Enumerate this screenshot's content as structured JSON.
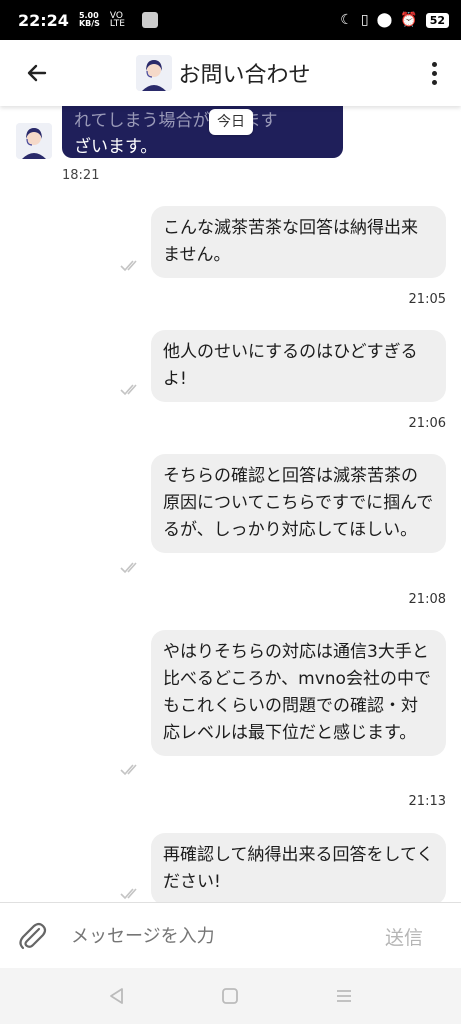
{
  "status_bar": {
    "time": "22:24",
    "net_speed": "5.00",
    "net_unit": "KB/S",
    "net_type": "VO LTE",
    "battery": "52"
  },
  "header": {
    "title": "お問い合わせ",
    "back_icon": "arrow-left-icon",
    "menu_icon": "more-vertical-icon"
  },
  "agent_message": {
    "line1": "れてしまう場合があります",
    "line2": "ざいます。",
    "time": "18:21"
  },
  "date_chip": "今日",
  "messages": [
    {
      "text": "こんな滅茶苦茶な回答は納得出来ません。",
      "time": "21:05"
    },
    {
      "text": "他人のせいにするのはひどすぎるよ!",
      "time": "21:06"
    },
    {
      "text": "そちらの確認と回答は滅茶苦茶の原因についてこちらですでに掴んでるが、しっかり対応してほしい。",
      "time": "21:08"
    },
    {
      "text": "やはりそちらの対応は通信3大手と比べるどころか、mvno会社の中でもこれくらいの問題での確認・対応レベルは最下位だと感じます。",
      "time": "21:13"
    },
    {
      "text": "再確認して納得出来る回答をしてください!",
      "time": ""
    }
  ],
  "composer": {
    "placeholder": "メッセージを入力",
    "send_label": "送信"
  },
  "colors": {
    "agent_bubble": "#1f1f5a",
    "user_bubble": "#efefef",
    "send_disabled": "#b5b5b5"
  }
}
